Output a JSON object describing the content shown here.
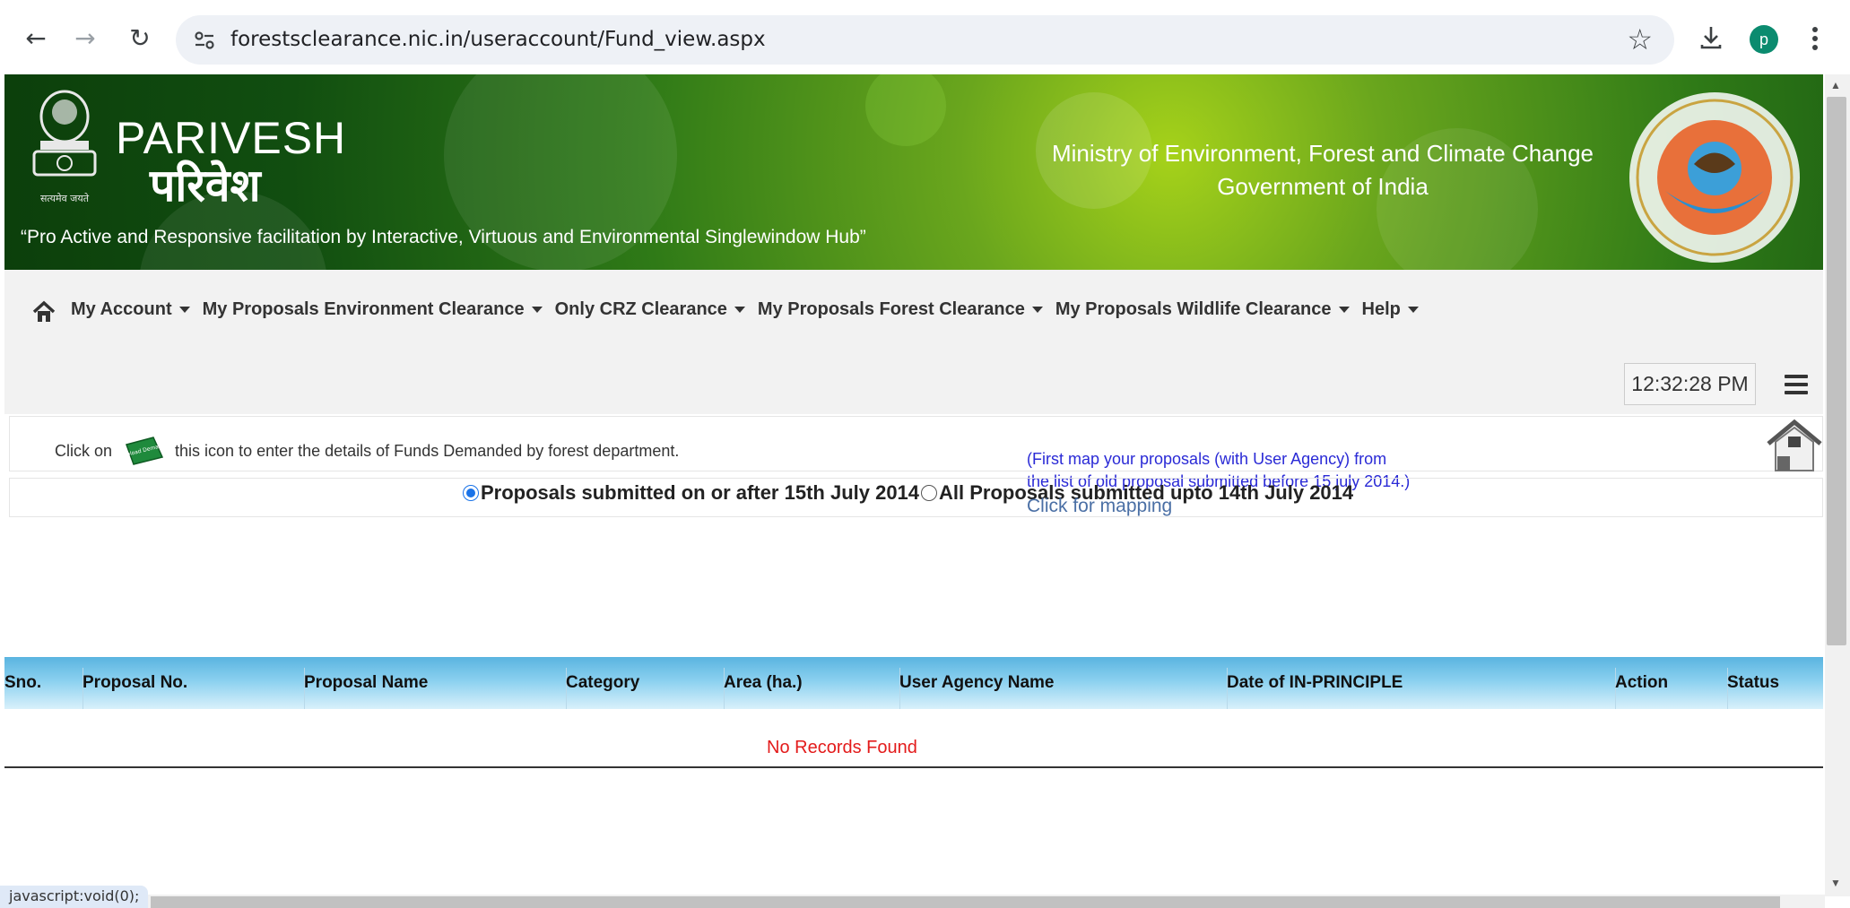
{
  "browser": {
    "url": "forestsclearance.nic.in/useraccount/Fund_view.aspx",
    "avatar_letter": "p",
    "status_text": "javascript:void(0);"
  },
  "banner": {
    "brand_en": "PARIVESH",
    "brand_hi": "परिवेश",
    "tagline": "“Pro Active and Responsive facilitation by Interactive, Virtuous and Environmental Singlewindow Hub”",
    "ministry_line1": "Ministry of Environment, Forest and Climate Change",
    "ministry_line2": "Government of India",
    "emblem_caption": "सत्यमेव जयते"
  },
  "menu": {
    "items": [
      {
        "label": "My Account"
      },
      {
        "label": "My Proposals Environment Clearance"
      },
      {
        "label": "Only CRZ Clearance"
      },
      {
        "label": "My Proposals Forest Clearance"
      },
      {
        "label": "My Proposals Wildlife Clearance"
      },
      {
        "label": "Help"
      }
    ],
    "clock": "12:32:28 PM"
  },
  "info": {
    "click_on": "Click on",
    "icon_text": "Upload Demand",
    "after_icon": "this icon to enter the details of Funds Demanded by forest department.",
    "map_note_line1": "(First map your proposals (with User Agency) from",
    "map_note_line2": "the list of old proposal submitted before 15 july 2014.)",
    "map_link": "Click for mapping"
  },
  "filters": {
    "option1": "Proposals submitted on or after 15th July 2014",
    "option2": "All Proposals submitted upto 14th July 2014",
    "selected": "option1"
  },
  "table": {
    "columns": [
      "Sno.",
      "Proposal No.",
      "Proposal Name",
      "Category",
      "Area (ha.)",
      "User Agency Name",
      "Date of IN-PRINCIPLE",
      "Action",
      "Status"
    ],
    "empty_message": "No Records Found"
  },
  "colors": {
    "header_green": "#114e10",
    "table_header_blue": "#5ab4e0",
    "empty_message": "#e31b1b",
    "map_note": "#2a2ad6"
  }
}
